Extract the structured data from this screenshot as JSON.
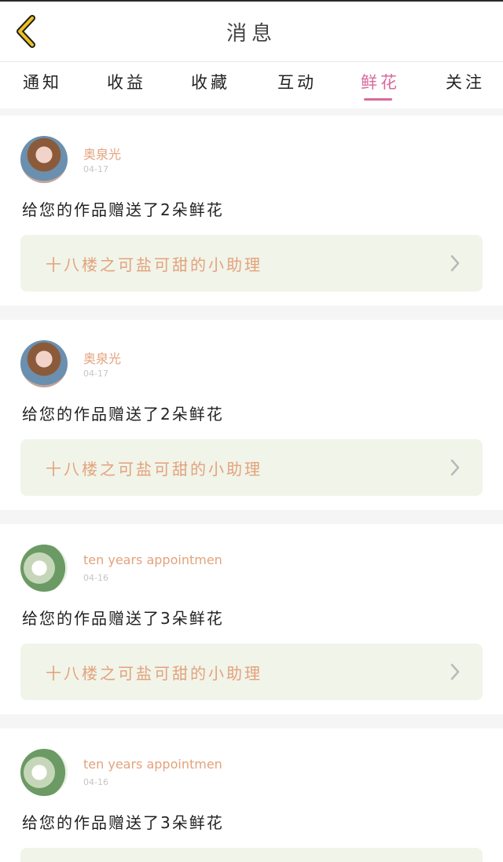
{
  "header": {
    "title": "消息",
    "back_icon": "chevron-left-icon",
    "accent_color": "#f0c020"
  },
  "tabs": [
    {
      "label": "通知"
    },
    {
      "label": "收益"
    },
    {
      "label": "收藏"
    },
    {
      "label": "互动"
    },
    {
      "label": "鲜花",
      "active": true
    },
    {
      "label": "关注"
    }
  ],
  "messages": [
    {
      "username": "奥泉光",
      "date": "04-17",
      "text": "给您的作品赠送了2朵鲜花",
      "work_title": "十八楼之可盐可甜的小助理"
    },
    {
      "username": "奥泉光",
      "date": "04-17",
      "text": "给您的作品赠送了2朵鲜花",
      "work_title": "十八楼之可盐可甜的小助理"
    },
    {
      "username": "ten years appointmen",
      "date": "04-16",
      "text": "给您的作品赠送了3朵鲜花",
      "work_title": "十八楼之可盐可甜的小助理"
    },
    {
      "username": "ten years appointmen",
      "date": "04-16",
      "text": "给您的作品赠送了3朵鲜花"
    }
  ]
}
